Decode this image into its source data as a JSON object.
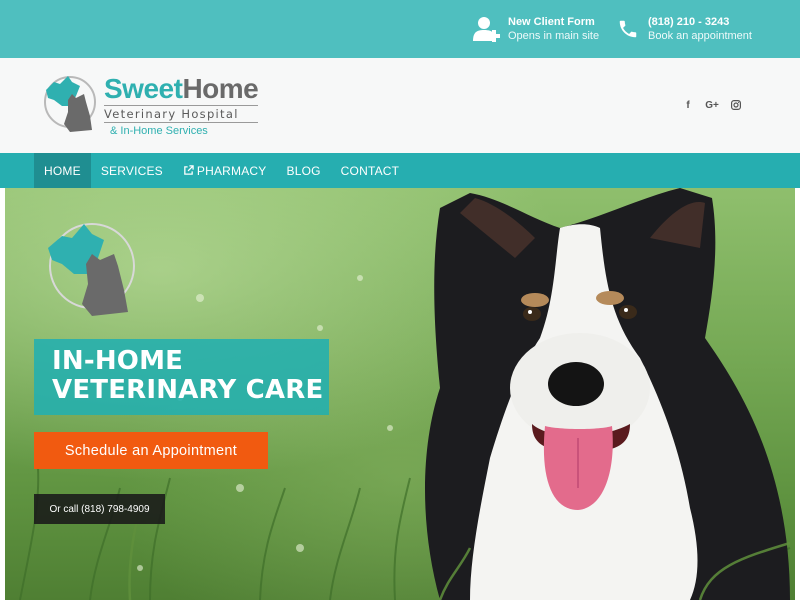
{
  "topbar": {
    "client_form": {
      "title": "New Client Form",
      "subtitle": "Opens in main site",
      "icon": "user-plus-icon"
    },
    "phone": {
      "title": "(818) 210 - 3243",
      "subtitle": "Book an appointment",
      "icon": "phone-icon"
    }
  },
  "logo": {
    "name_part1": "Sweet",
    "name_part2": "Home",
    "subtitle": "Veterinary Hospital",
    "tagline": "& In-Home Services"
  },
  "social": [
    {
      "icon": "facebook-icon",
      "glyph": "f"
    },
    {
      "icon": "google-plus-icon",
      "glyph": "G+"
    },
    {
      "icon": "instagram-icon",
      "glyph": ""
    }
  ],
  "nav": {
    "items": [
      {
        "label": "HOME",
        "active": true
      },
      {
        "label": "SERVICES"
      },
      {
        "label": "PHARMACY",
        "icon": "external-link-icon"
      },
      {
        "label": "BLOG"
      },
      {
        "label": "CONTACT"
      }
    ]
  },
  "hero": {
    "title_line1": "IN-HOME",
    "title_line2": "VETERINARY CARE",
    "cta_label": "Schedule an Appointment",
    "call_label": "Or call (818) 798-4909"
  },
  "colors": {
    "teal": "#4fbfbf",
    "nav_teal": "#26aeb0",
    "nav_active": "#1f8e91",
    "orange": "#f15a10",
    "logo_teal": "#2fb0b0",
    "logo_gray": "#6a6a6a"
  }
}
